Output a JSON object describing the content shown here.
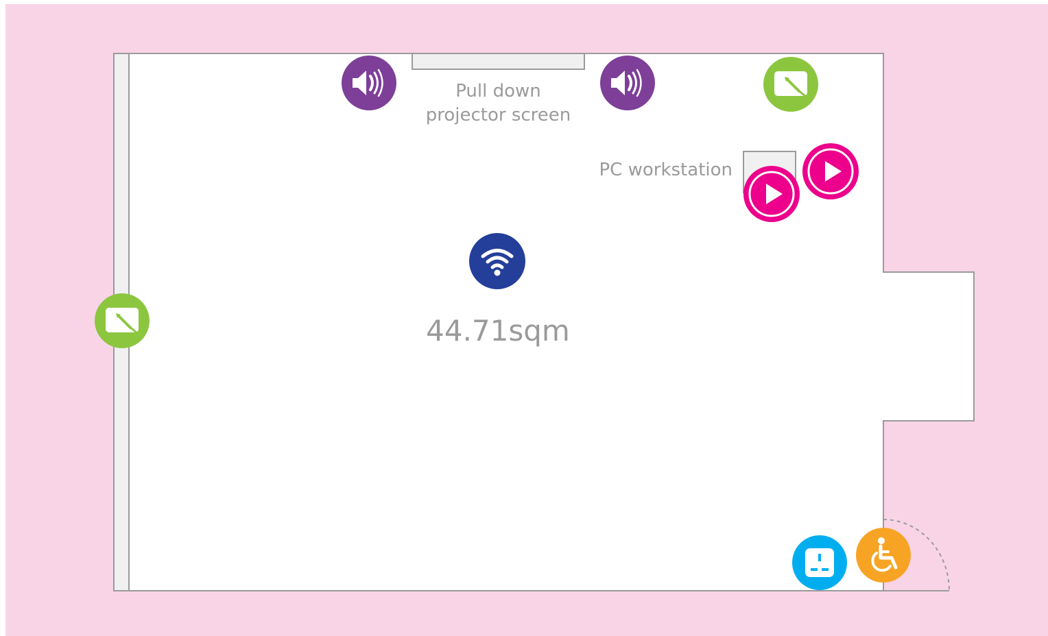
{
  "room": {
    "area": "44.71sqm"
  },
  "labels": {
    "screen_line1": "Pull down",
    "screen_line2": "projector screen",
    "pc_workstation": "PC workstation"
  },
  "colors": {
    "background": "#f9d4e7",
    "room_fill": "#ffffff",
    "wall": "#9a9a9a",
    "speaker": "#7d3f98",
    "whiteboard": "#8cc63f",
    "play": "#ec008c",
    "wifi": "#233f99",
    "power": "#00aeef",
    "accessible": "#f7a425",
    "label_text": "#9a9a9a"
  },
  "icons": [
    "speaker-icon",
    "speaker-icon",
    "whiteboard-icon",
    "whiteboard-icon",
    "play-icon",
    "play-icon",
    "wifi-icon",
    "power-socket-icon",
    "wheelchair-accessible-icon"
  ]
}
